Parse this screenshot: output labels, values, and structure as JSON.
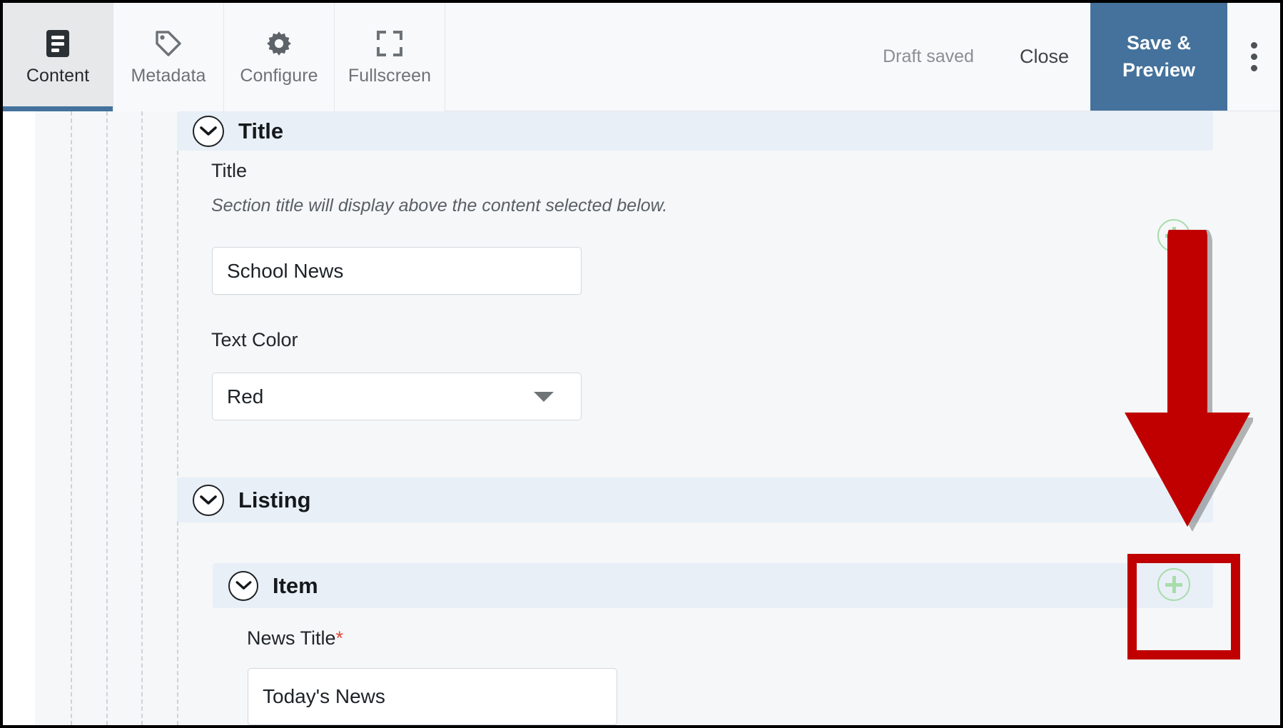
{
  "toolbar": {
    "tabs": [
      {
        "label": "Content",
        "icon": "document-icon",
        "active": true
      },
      {
        "label": "Metadata",
        "icon": "tag-icon",
        "active": false
      },
      {
        "label": "Configure",
        "icon": "gear-icon",
        "active": false
      },
      {
        "label": "Fullscreen",
        "icon": "fullscreen-icon",
        "active": false
      }
    ],
    "draft_status": "Draft saved",
    "close_label": "Close",
    "save_preview_label": "Save & Preview",
    "overflow_icon": "kebab-menu-icon",
    "accent_color": "#44729c"
  },
  "sections": {
    "title": {
      "heading": "Title",
      "fields": {
        "title": {
          "label": "Title",
          "help": "Section title will display above the content selected below.",
          "value": "School News",
          "placeholder": ""
        },
        "text_color": {
          "label": "Text Color",
          "value": "Red",
          "options": [
            "Red"
          ]
        }
      }
    },
    "listing": {
      "heading": "Listing",
      "item": {
        "heading": "Item",
        "fields": {
          "news_title": {
            "label": "News Title",
            "required_marker": "*",
            "value": "Today's News",
            "placeholder": ""
          }
        }
      }
    }
  },
  "buttons": {
    "add_title_section": "add-section-plus",
    "add_listing_item": "add-item-plus"
  },
  "annotations": {
    "arrow_color": "#c00000",
    "highlight_color": "#c00000"
  },
  "colors": {
    "section_header_bg": "#e8eff7",
    "canvas_bg": "#f5f7f8",
    "plus_green": "#a9dcab",
    "required_red": "#e8453c"
  }
}
